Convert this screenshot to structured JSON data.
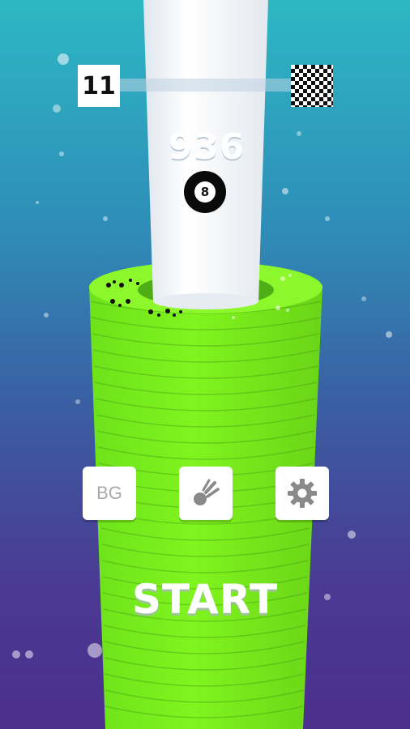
{
  "game": {
    "level": "11",
    "score": "936",
    "progress": 0.0
  },
  "ball": {
    "number": "8",
    "icon": "eight-ball-icon"
  },
  "menu": {
    "bg_label": "BG",
    "balls_icon": "ball-skin-icon",
    "settings_icon": "gear-icon",
    "start_label": "START"
  },
  "colors": {
    "tower": "#7ff51d",
    "pillar": "#ffffff",
    "background_top": "#2db7c4",
    "background_bottom": "#4b2f8c"
  }
}
